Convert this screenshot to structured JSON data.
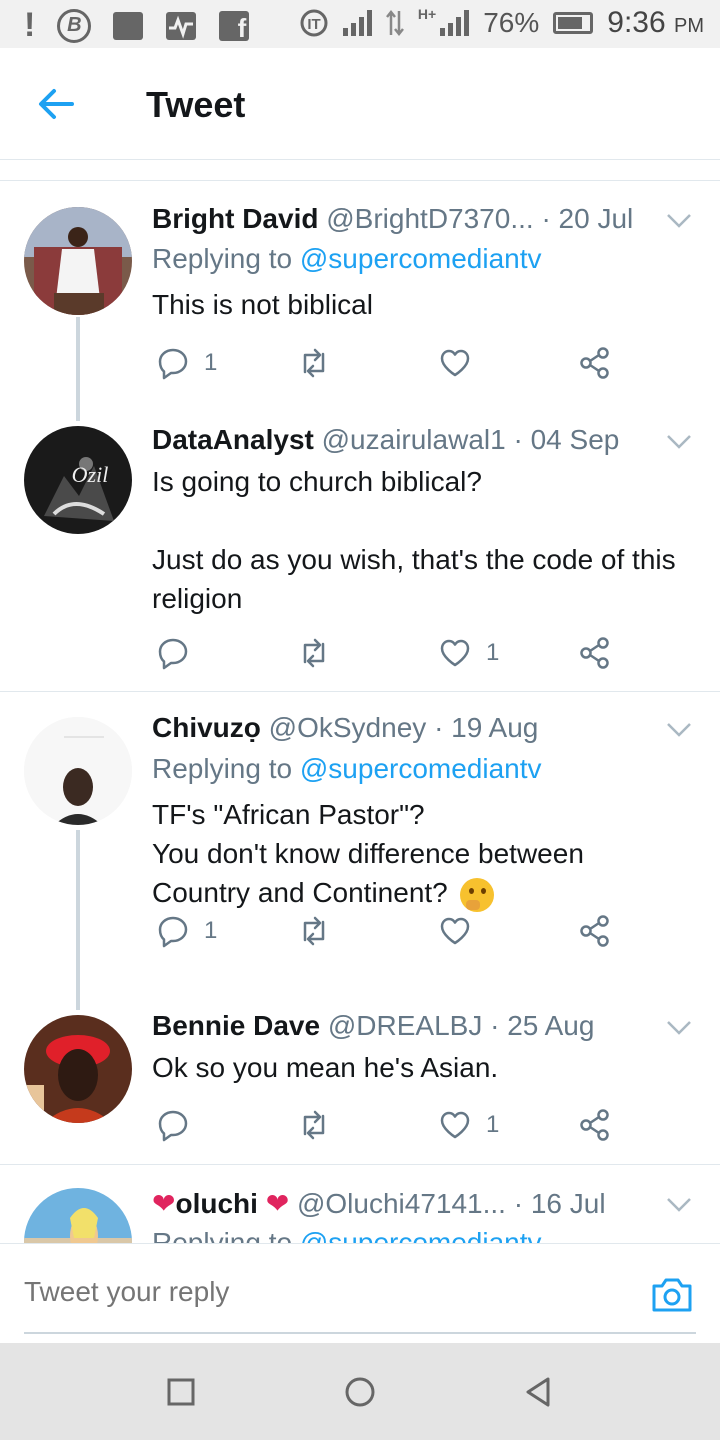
{
  "status_bar": {
    "battery": "76%",
    "time": "9:36",
    "ampm": "PM",
    "network": "H+",
    "icons": [
      "alert-icon",
      "b-circle-icon",
      "image-icon",
      "activity-icon",
      "facebook-icon",
      "hotspot-icon",
      "signal-icon",
      "data-arrows-icon",
      "signal-icon",
      "battery-icon"
    ]
  },
  "header": {
    "title": "Tweet"
  },
  "colors": {
    "accent": "#1da1f2",
    "muted": "#657786",
    "text": "#14171a",
    "divider": "#e1e8ed"
  },
  "tweets": [
    {
      "name": "Bright David",
      "handle": "@BrightD7370...",
      "date": "· 20 Jul",
      "replying_label": "Replying to",
      "replying_handle": "@supercomediantv",
      "text": "This is not biblical",
      "replies": "1",
      "retweets": "",
      "likes": ""
    },
    {
      "name": "DataAnalyst",
      "handle": "@uzairulawal1",
      "date": "· 04 Sep",
      "text": "Is going to church biblical?\n\nJust do as you wish, that's the code of this religion",
      "replies": "",
      "retweets": "",
      "likes": "1",
      "avatar_text": "Ozil"
    },
    {
      "name": "Chivuzọ",
      "handle": "@OkSydney",
      "date": "· 19 Aug",
      "replying_label": "Replying to",
      "replying_handle": "@supercomediantv",
      "text": "TF's \"African Pastor\"?\nYou don't know difference between Country and Continent?",
      "replies": "1",
      "retweets": "",
      "likes": ""
    },
    {
      "name": "Bennie Dave",
      "handle": "@DREALBJ",
      "date": "· 25 Aug",
      "text": "Ok so you mean he's Asian.",
      "replies": "",
      "retweets": "",
      "likes": "1"
    },
    {
      "name": "oluchi",
      "name_prefix": "❤",
      "name_suffix": "❤",
      "handle": "@Oluchi47141...",
      "date": "· 16 Jul",
      "replying_label": "Replying to",
      "replying_handle": "@supercomediantv"
    }
  ],
  "reply_bar": {
    "placeholder": "Tweet your reply"
  }
}
